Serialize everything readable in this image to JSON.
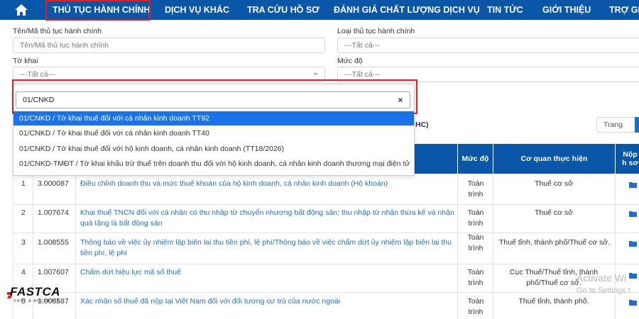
{
  "nav": {
    "items": [
      {
        "label": "THỦ TỤC HÀNH CHÍNH"
      },
      {
        "label": "DỊCH VỤ KHÁC"
      },
      {
        "label": "TRA CỨU HỒ SƠ"
      },
      {
        "label": "ĐÁNH GIÁ CHẤT LƯỢNG DỊCH VỤ"
      },
      {
        "label": "TIN TỨC"
      },
      {
        "label": "GIỚI THIỆU"
      },
      {
        "label": "TRỢ GIÚ"
      }
    ],
    "home_icon": "home-icon"
  },
  "form": {
    "ten_ma_label": "Tên/Mã thủ tục hành chính",
    "ten_ma_placeholder": "Tên/Mã thủ tục hành chính",
    "loai_label": "Loại thủ tục hành chính",
    "loai_value": "---Tất cả---",
    "to_khai_label": "Tờ khai",
    "to_khai_value": "---Tất cả---",
    "muc_do_label": "Mức độ",
    "muc_do_value": "---Tất cả---"
  },
  "dropdown": {
    "search_value": "01/CNKD",
    "clear_label": "×",
    "options": [
      {
        "label": "01/CNKD / Tờ khai thuế đối với cá nhân kinh doanh TT92",
        "selected": true
      },
      {
        "label": "01/CNKD / Tờ khai thuế đối với cá nhân kinh doanh TT40",
        "selected": false
      },
      {
        "label": "01/CNKD / Tờ khai thuế đối với hộ kinh doanh, cá nhân kinh doanh (TT18/2026)",
        "selected": false
      },
      {
        "label": "01/CNKD-TMĐT / Tờ khai khấu trừ thuế trên doanh thu đối với hộ kinh doanh, cá nhân kinh doanh thương mại điện tử",
        "selected": false
      }
    ]
  },
  "results": {
    "hc_tail": "HC)",
    "page_label": "Trang"
  },
  "table": {
    "headers": {
      "muc_do": "Mức độ",
      "co_quan": "Cơ quan thực hiện",
      "nop": "Nộp h sơ"
    },
    "rows": [
      {
        "stt": "1",
        "ma": "3.000087",
        "ten": "Điều chỉnh doanh thu và mức thuế khoán của hộ kinh doanh, cá nhân kinh doanh (Hộ khoán)",
        "muc_do": "Toàn trình",
        "co_quan": "Thuế cơ sở"
      },
      {
        "stt": "2",
        "ma": "1.007674",
        "ten": "Khai thuế TNCN đối với cá nhân có thu nhập từ chuyển nhượng bất động sản; thu nhập từ nhận thừa kế và nhận quà tặng là bất động sản",
        "muc_do": "Toàn trình",
        "co_quan": "Thuế cơ sở"
      },
      {
        "stt": "3",
        "ma": "1.008555",
        "ten": "Thông báo về việc ủy nhiệm lập biên lai thu tiền phí, lệ phí/Thông báo về việc chấm dứt ủy nhiệm lập biên lai thu tiền phí, lệ phí",
        "muc_do": "Toàn trình",
        "co_quan": "Thuế tỉnh, thành phố/Thuế cơ sở."
      },
      {
        "stt": "4",
        "ma": "1.007607",
        "ten": "Chấm dứt hiệu lực mã số thuế",
        "muc_do": "Toàn trình",
        "co_quan": "Cục Thuế/Thuế tỉnh, thành phố/Thuế cơ sở."
      },
      {
        "stt": "5",
        "ma": "1.008587",
        "ten": "Xác nhận số thuế đã nộp tại Việt Nam đối với đối tượng cư trú của nước ngoài",
        "muc_do": "Toàn trình",
        "co_quan": "Thuế tỉnh, thành phố."
      }
    ]
  },
  "overlay": {
    "watermark_line1": "Activate Wi",
    "watermark_line2": "Go to Settings t",
    "logo_text": "FASTCA",
    "logo_tagline": "FAST & ACCURATE"
  },
  "colors": {
    "nav_bg": "#0a56a8",
    "highlight_red": "#e02020",
    "link_blue": "#1f6fd1",
    "selected_blue": "#1a73e8"
  }
}
